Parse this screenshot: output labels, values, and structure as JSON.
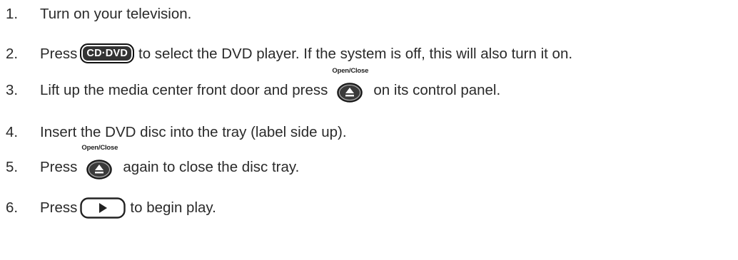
{
  "steps": [
    {
      "number": "1.",
      "text": "Turn on your television."
    },
    {
      "number": "2.",
      "before": "Press",
      "after": "to select the DVD player. If the system is off, this will also turn it on.",
      "button_label_left": "CD",
      "button_label_sep": "·",
      "button_label_right": "DVD"
    },
    {
      "number": "3.",
      "before": "Lift up the media center front door and press",
      "after": "on its control panel.",
      "button_label": "Open/Close"
    },
    {
      "number": "4.",
      "text": "Insert the DVD disc into the tray (label side up)."
    },
    {
      "number": "5.",
      "before": "Press",
      "after": "again to close the disc tray.",
      "button_label": "Open/Close"
    },
    {
      "number": "6.",
      "before": "Press",
      "after": "to begin play."
    }
  ],
  "icons": {
    "cd_dvd": "cd-dvd-button-icon",
    "eject": "eject-icon",
    "play": "play-icon"
  },
  "colors": {
    "text": "#2a2a2a",
    "button_fill": "#333333",
    "button_outline": "#111111"
  }
}
